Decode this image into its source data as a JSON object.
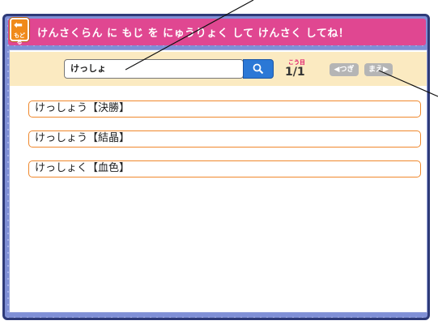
{
  "titlebar": {
    "back_label": "もどる",
    "title": "けんさくらん に もじ を にゅうりょく して けんさく してね！"
  },
  "search": {
    "value": "けっしょ",
    "hits_label": "こう目",
    "hits_count": "1/1",
    "next_label": "◀つぎ",
    "prev_label": "まえ▶"
  },
  "results": [
    {
      "label": "けっしょう【決勝】"
    },
    {
      "label": "けっしょう【結晶】"
    },
    {
      "label": "けっしょく【血色】"
    }
  ],
  "colors": {
    "title_bar": "#e04791",
    "frame": "#7f8fd6",
    "search_bar": "#fbeac1",
    "result_border": "#f0882c",
    "search_button": "#2b78d6"
  }
}
